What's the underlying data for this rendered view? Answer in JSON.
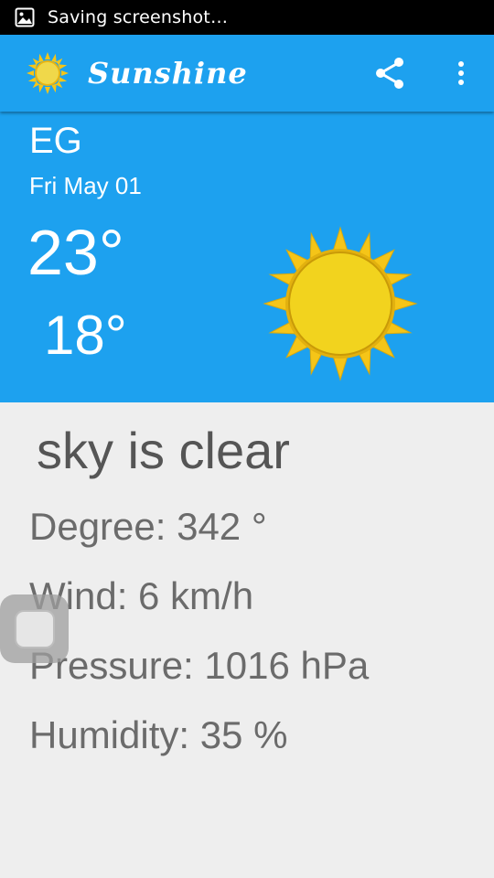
{
  "status_bar": {
    "notification_text": "Saving screenshot…",
    "icon": "image-icon"
  },
  "app_bar": {
    "title": "Sunshine",
    "logo_icon": "sun-icon",
    "share_icon": "share-icon",
    "overflow_icon": "overflow-menu-icon",
    "color": "#1da1ef"
  },
  "today": {
    "location": "EG",
    "date": "Fri May 01",
    "high": "23°",
    "low": "18°",
    "art_icon": "clear-sky-sun-icon"
  },
  "details": {
    "condition": "sky is clear",
    "degree": "Degree: 342 °",
    "wind": "Wind: 6 km/h",
    "pressure": "Pressure: 1016 hPa",
    "humidity": "Humidity: 35 %"
  },
  "colors": {
    "primary": "#1da1ef",
    "background": "#eeeeee",
    "detail_text": "#6b6b6b",
    "sun_yellow": "#f2d31e",
    "sun_ray": "#f5c518"
  }
}
